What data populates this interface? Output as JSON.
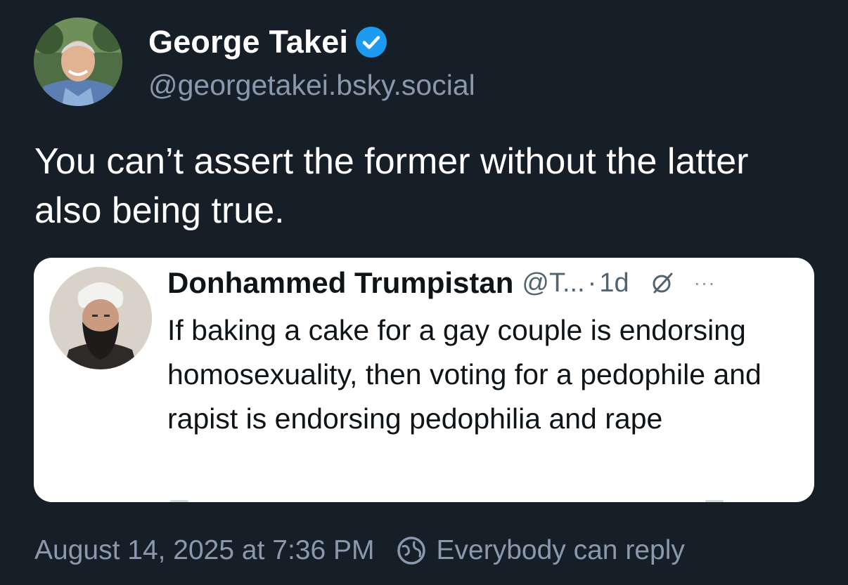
{
  "post": {
    "author_name": "George Takei",
    "author_handle": "@georgetakei.bsky.social",
    "text": "You can’t assert the former without the latter also being true.",
    "timestamp": "August 14, 2025 at 7:36 PM",
    "reply_setting": "Everybody can reply"
  },
  "quote": {
    "author_name": "Donhammed Trumpistan",
    "author_handle": "@T...",
    "separator": "·",
    "time": "1d",
    "more_label": "···",
    "text": "If baking a cake for a gay couple is endorsing homosexuality, then voting for a pedophile and rapist is endorsing pedophilia and rape"
  },
  "colors": {
    "background": "#161e27",
    "verified": "#1d9bf0",
    "muted": "#8a99ad",
    "card_bg": "#ffffff"
  },
  "icons": {
    "verified": "verified-check-icon",
    "grok": "grok-icon",
    "more": "more-dots-icon",
    "reply": "globe-reply-icon"
  }
}
